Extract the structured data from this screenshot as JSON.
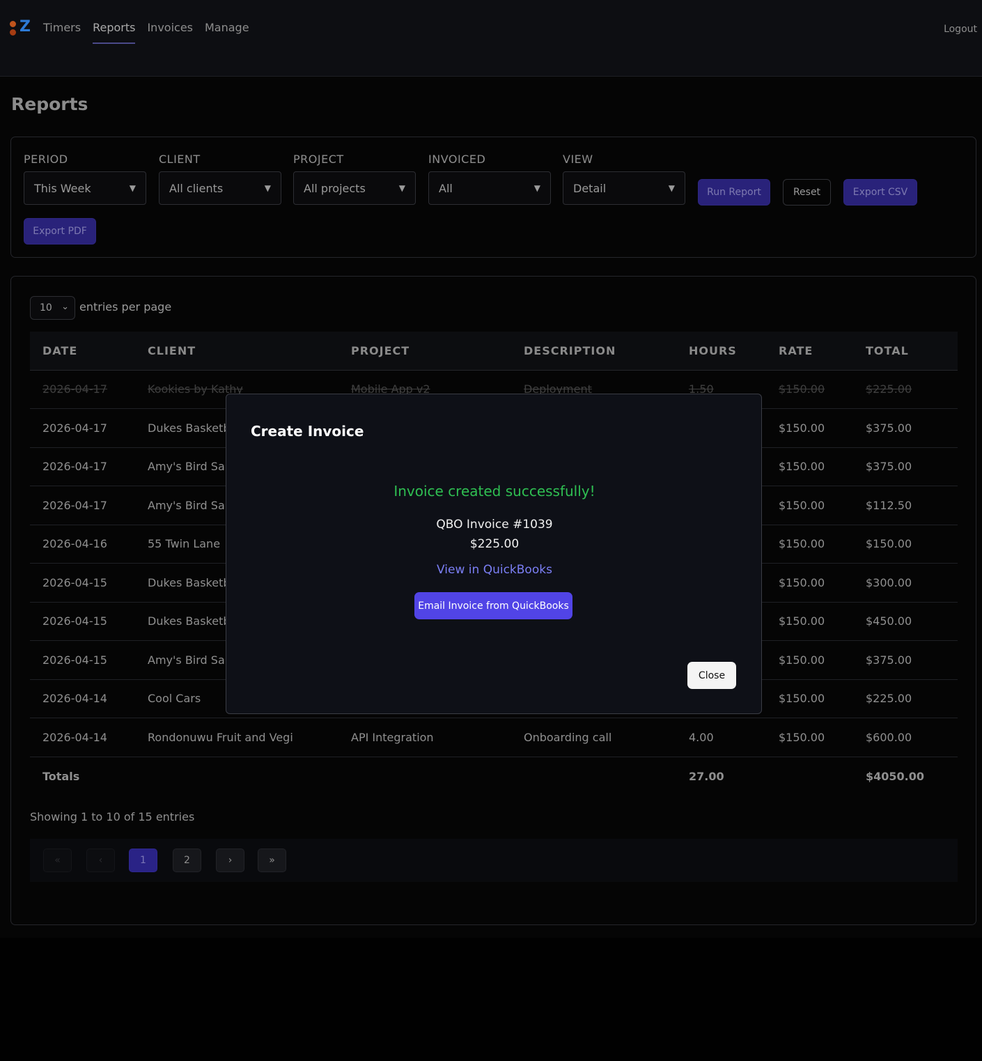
{
  "nav": {
    "links": [
      "Timers",
      "Reports",
      "Invoices",
      "Manage"
    ],
    "logout": "Logout"
  },
  "page": {
    "title": "Reports"
  },
  "filters": {
    "period": {
      "label": "PERIOD",
      "value": "This Week"
    },
    "client": {
      "label": "CLIENT",
      "value": "All clients"
    },
    "project": {
      "label": "PROJECT",
      "value": "All projects"
    },
    "invoiced": {
      "label": "INVOICED",
      "value": "All"
    },
    "view": {
      "label": "VIEW",
      "value": "Detail"
    },
    "run_report": "Run Report",
    "reset": "Reset",
    "export_csv": "Export CSV",
    "export_pdf": "Export PDF"
  },
  "table": {
    "per_page_value": "10",
    "per_page_label": "entries per page",
    "headers": [
      "DATE",
      "CLIENT",
      "PROJECT",
      "DESCRIPTION",
      "HOURS",
      "RATE",
      "TOTAL"
    ],
    "rows": [
      [
        "2026-04-17",
        "Kookies by Kathy",
        "Mobile App v2",
        "Deployment",
        "1.50",
        "$150.00",
        "$225.00"
      ],
      [
        "2026-04-17",
        "Dukes Basketba",
        "",
        "",
        "",
        "$150.00",
        "$375.00"
      ],
      [
        "2026-04-17",
        "Amy's Bird San",
        "",
        "",
        "",
        "$150.00",
        "$375.00"
      ],
      [
        "2026-04-17",
        "Amy's Bird San",
        "",
        "",
        "",
        "$150.00",
        "$112.50"
      ],
      [
        "2026-04-16",
        "55 Twin Lane",
        "",
        "",
        "",
        "$150.00",
        "$150.00"
      ],
      [
        "2026-04-15",
        "Dukes Basketba",
        "",
        "",
        "",
        "$150.00",
        "$300.00"
      ],
      [
        "2026-04-15",
        "Dukes Basketba",
        "",
        "",
        "",
        "$150.00",
        "$450.00"
      ],
      [
        "2026-04-15",
        "Amy's Bird San",
        "",
        "",
        "",
        "$150.00",
        "$375.00"
      ],
      [
        "2026-04-14",
        "Cool Cars",
        "",
        "",
        "",
        "$150.00",
        "$225.00"
      ],
      [
        "2026-04-14",
        "Rondonuwu Fruit and Vegi",
        "API Integration",
        "Onboarding call",
        "4.00",
        "$150.00",
        "$600.00"
      ]
    ],
    "totals": {
      "label": "Totals",
      "hours": "27.00",
      "total": "$4050.00"
    },
    "showing": "Showing 1 to 10 of 15 entries",
    "pager": [
      "«",
      "‹",
      "1",
      "2",
      "›",
      "»"
    ]
  },
  "modal": {
    "title": "Create Invoice",
    "success": "Invoice created successfully!",
    "invoice_number": "QBO Invoice #1039",
    "amount": "$225.00",
    "view_link": "View in QuickBooks",
    "email_button": "Email Invoice from QuickBooks",
    "close_button": "Close"
  },
  "colors": {
    "primary": "#5144e6",
    "success": "#2fbf52",
    "link": "#7b7ff5",
    "background": "#050505"
  }
}
